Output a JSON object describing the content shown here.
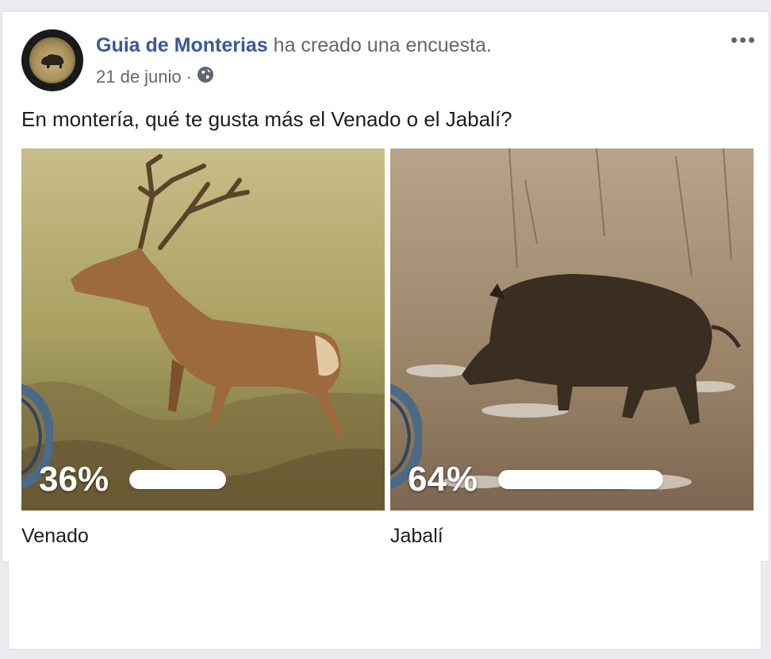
{
  "post": {
    "author": "Guia de Monterias",
    "action": "ha creado una encuesta.",
    "date": "21 de junio",
    "separator": "·",
    "privacy_icon": "globe-icon",
    "question": "En montería, qué te gusta más el Venado o el Jabalí?"
  },
  "poll": {
    "options": [
      {
        "label": "Venado",
        "percent_text": "36%",
        "percent": 36
      },
      {
        "label": "Jabalí",
        "percent_text": "64%",
        "percent": 64
      }
    ],
    "bar_color": "#ffffff"
  },
  "colors": {
    "link": "#385898",
    "meta": "#616770",
    "text": "#1c1e21"
  }
}
